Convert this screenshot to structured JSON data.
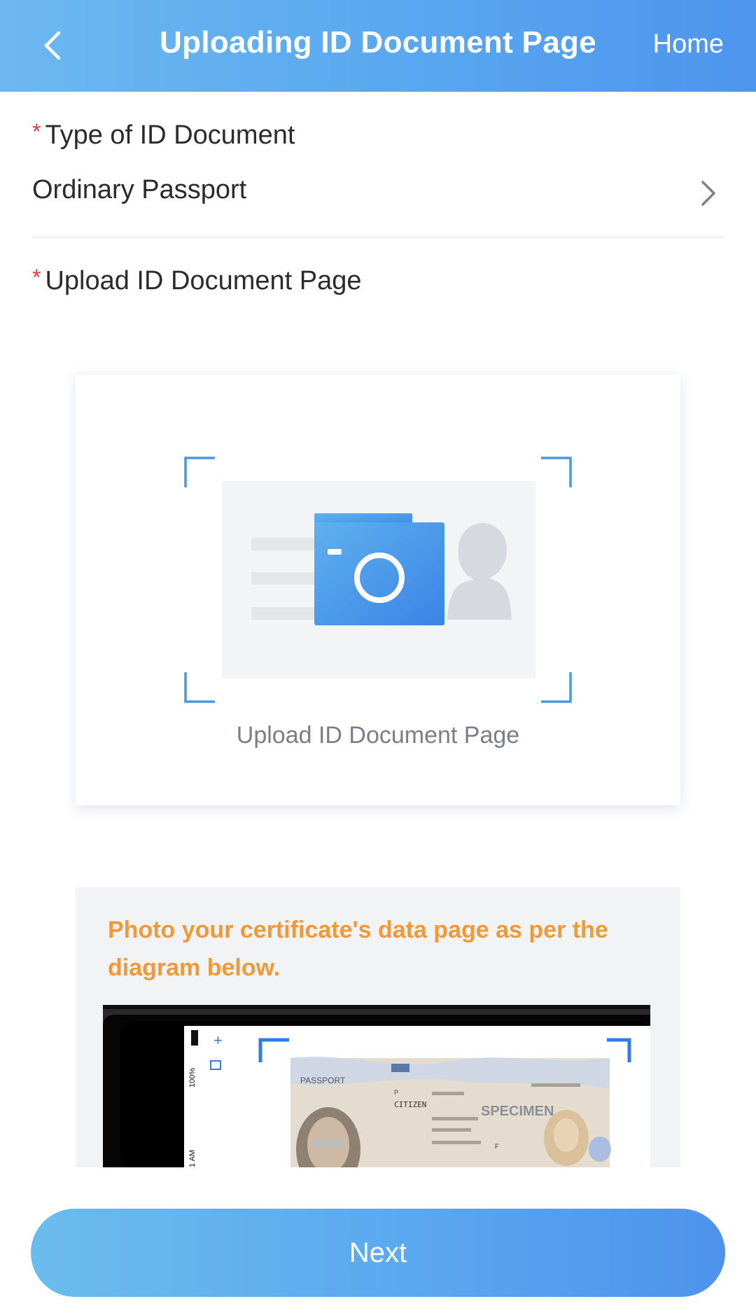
{
  "header": {
    "title": "Uploading ID Document Page",
    "home_label": "Home"
  },
  "form": {
    "required_mark": "*",
    "id_type": {
      "label": "Type of ID Document",
      "value": "Ordinary Passport"
    },
    "upload": {
      "label": "Upload ID Document Page",
      "caption": "Upload ID Document Page"
    }
  },
  "tip": {
    "text": "Photo your certificate's data page as per the diagram below.",
    "diagram": {
      "battery_text": "100%",
      "time_text": "1 AM",
      "doc_title": "PASSPORT",
      "doc_type": "P",
      "doc_nationality": "CITIZEN",
      "doc_watermark": "SPECIMEN",
      "doc_sex": "F"
    }
  },
  "footer": {
    "next_label": "Next"
  },
  "colors": {
    "header_gradient_start": "#6db8f1",
    "header_gradient_end": "#4d95ee",
    "accent_blue": "#4a90e2",
    "required_red": "#e03b3b",
    "tip_orange": "#f0993a"
  }
}
